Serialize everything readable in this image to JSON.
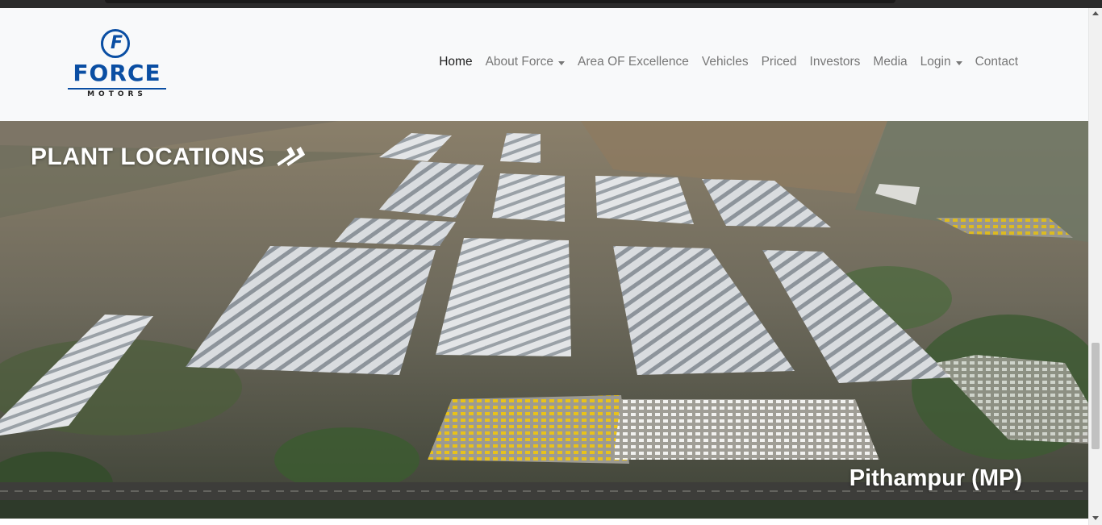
{
  "brand": {
    "logo_letter": "F",
    "name": "FORCE",
    "tagline": "MOTORS",
    "color": "#0a4ea3"
  },
  "nav": {
    "items": [
      {
        "label": "Home",
        "active": true,
        "dropdown": false
      },
      {
        "label": "About Force",
        "active": false,
        "dropdown": true
      },
      {
        "label": "Area OF Excellence",
        "active": false,
        "dropdown": false
      },
      {
        "label": "Vehicles",
        "active": false,
        "dropdown": false
      },
      {
        "label": "Priced",
        "active": false,
        "dropdown": false
      },
      {
        "label": "Investors",
        "active": false,
        "dropdown": false
      },
      {
        "label": "Media",
        "active": false,
        "dropdown": false
      },
      {
        "label": "Login",
        "active": false,
        "dropdown": true
      },
      {
        "label": "Contact",
        "active": false,
        "dropdown": false
      }
    ]
  },
  "hero": {
    "title": "PLANT LOCATIONS",
    "arrow_icon": "double-chevron-right-icon",
    "location": "Pithampur (MP)"
  }
}
